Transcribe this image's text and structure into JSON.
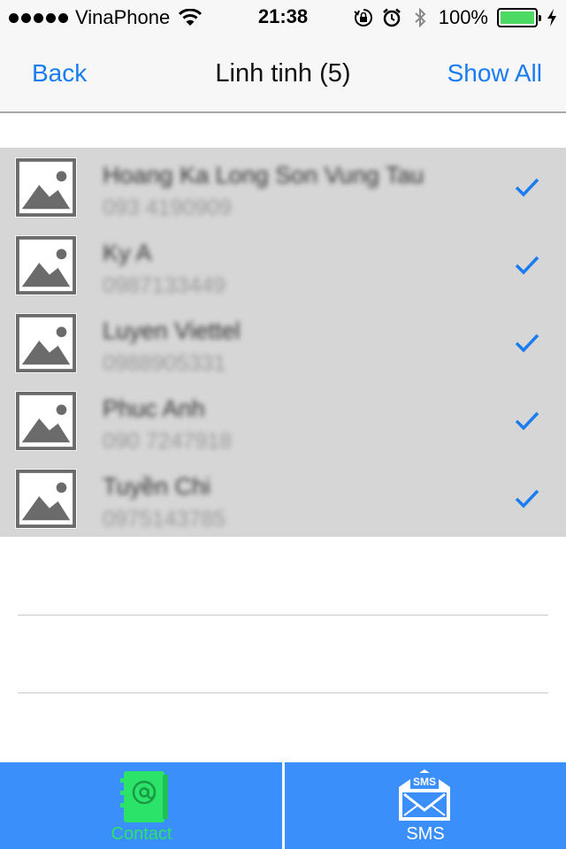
{
  "status_bar": {
    "carrier": "VinaPhone",
    "time": "21:38",
    "battery_percent": "100%",
    "signal_dots": 5,
    "battery_level": 1.0
  },
  "nav": {
    "back_label": "Back",
    "title": "Linh tinh (5)",
    "show_all_label": "Show All"
  },
  "contacts": [
    {
      "name": "Hoang Ka Long Son Vung Tau",
      "phone": "093 4190909",
      "selected": true
    },
    {
      "name": "Ky A",
      "phone": "0987133449",
      "selected": true
    },
    {
      "name": "Luyen Viettel",
      "phone": "0988905331",
      "selected": true
    },
    {
      "name": "Phuc Anh",
      "phone": "090 7247918",
      "selected": true
    },
    {
      "name": "Tuyền Chi",
      "phone": "0975143785",
      "selected": true
    }
  ],
  "tab_bar": {
    "tabs": [
      {
        "label": "Contact",
        "icon": "address-book-icon",
        "active": true
      },
      {
        "label": "SMS",
        "icon": "sms-envelope-icon",
        "active": false
      }
    ],
    "sms_badge_text": "SMS"
  },
  "colors": {
    "accent": "#1a7cf0",
    "tab_bar_bg": "#3b8ffa",
    "active_tab": "#2ce36a",
    "selected_row_bg": "#d6d6d6"
  }
}
